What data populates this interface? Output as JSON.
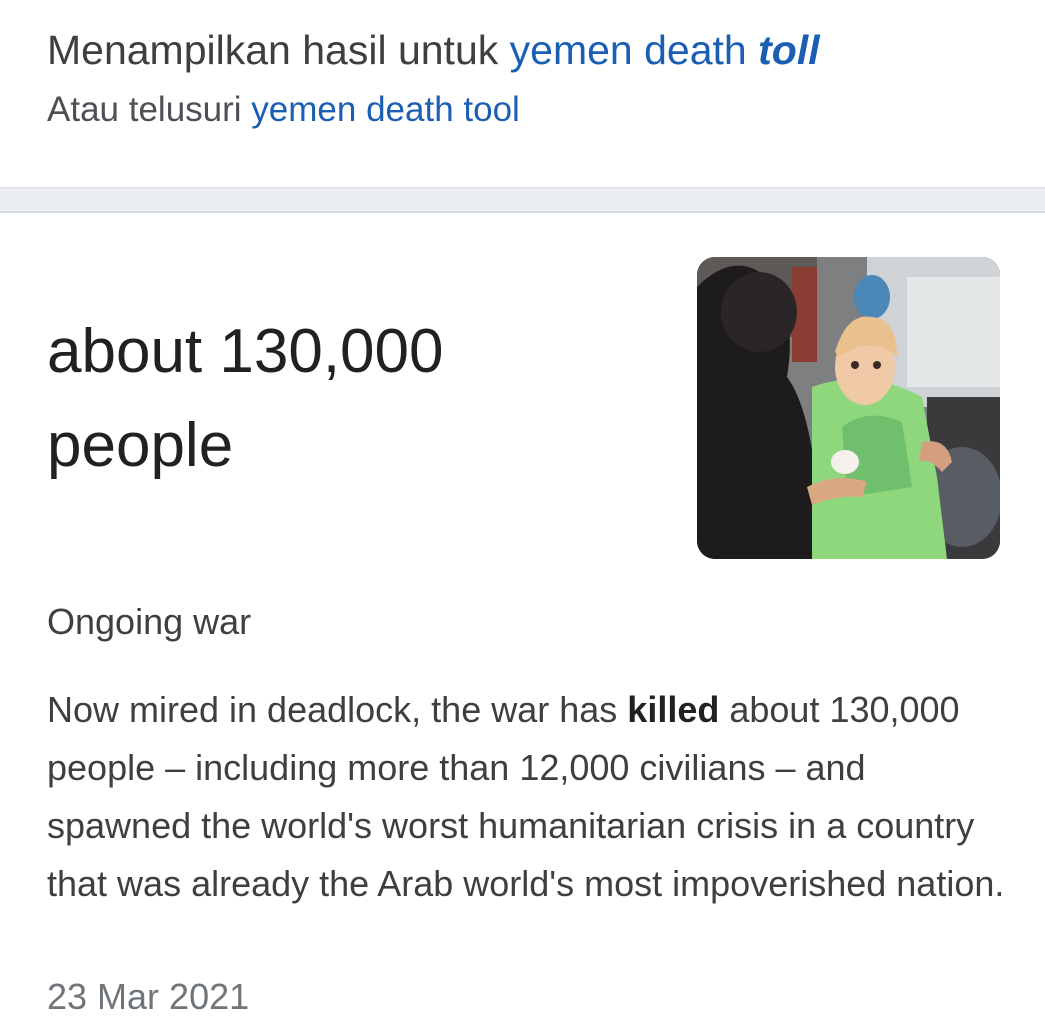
{
  "spelling": {
    "prefix": "Menampilkan hasil untuk",
    "corrected_part1": "yemen death",
    "corrected_part2": "toll",
    "alt_prefix": "Atau telusuri",
    "alt_query": "yemen death tool"
  },
  "featured": {
    "answer_line1": "about 130,000",
    "answer_line2": "people",
    "subtitle": "Ongoing war",
    "snippet_before": "Now mired in deadlock, the war has",
    "snippet_bold": "killed",
    "snippet_after": "about 130,000 people – including more than 12,000 civilians – and spawned the world's worst humanitarian crisis in a country that was already the Arab world's most impoverished nation.",
    "date": "23 Mar 2021"
  },
  "colors": {
    "link": "#1a5fb4",
    "text": "#3c4043",
    "muted": "#70757a"
  },
  "icons": {
    "thumbnail": "photo-thumbnail"
  }
}
